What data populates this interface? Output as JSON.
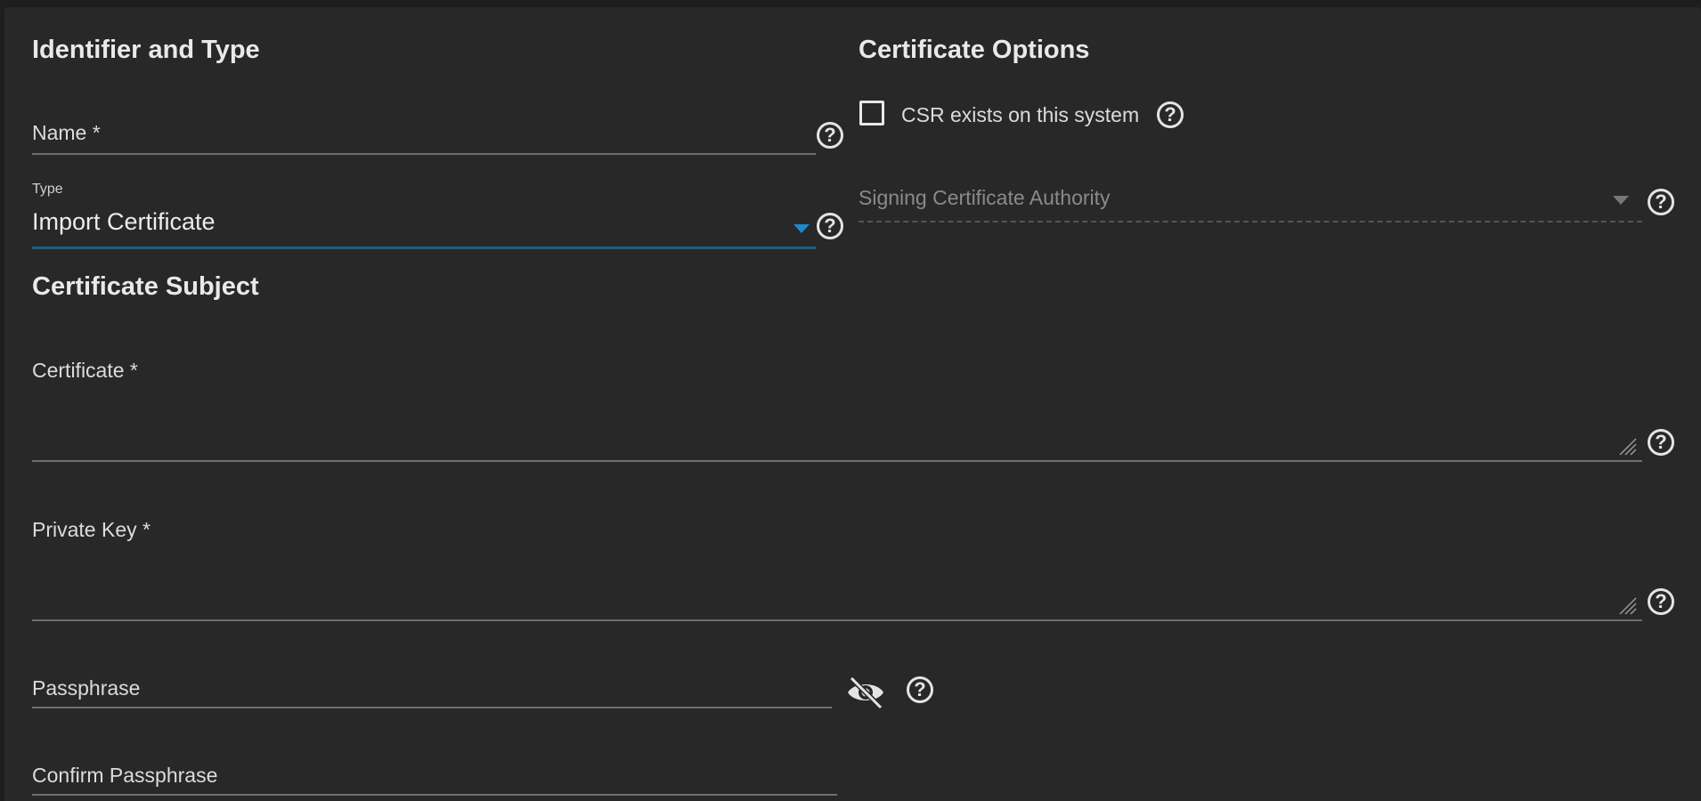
{
  "sections": {
    "identifier_title": "Identifier and Type",
    "subject_title": "Certificate Subject",
    "options_title": "Certificate Options"
  },
  "fields": {
    "name_label": "Name *",
    "type_small_label": "Type",
    "type_value": "Import Certificate",
    "certificate_label": "Certificate *",
    "private_key_label": "Private Key *",
    "passphrase_label": "Passphrase",
    "confirm_passphrase_label": "Confirm Passphrase"
  },
  "options": {
    "csr_label": "CSR exists on this system",
    "csr_checked": false,
    "signing_ca_placeholder": "Signing Certificate Authority"
  },
  "help_glyph": "?",
  "icons": {
    "help": "help-circle-icon",
    "dropdown": "caret-down-icon",
    "visibility": "eye-off-icon",
    "resize": "resize-handle-icon"
  },
  "colors": {
    "accent": "#1e88c9",
    "background": "#282828"
  }
}
